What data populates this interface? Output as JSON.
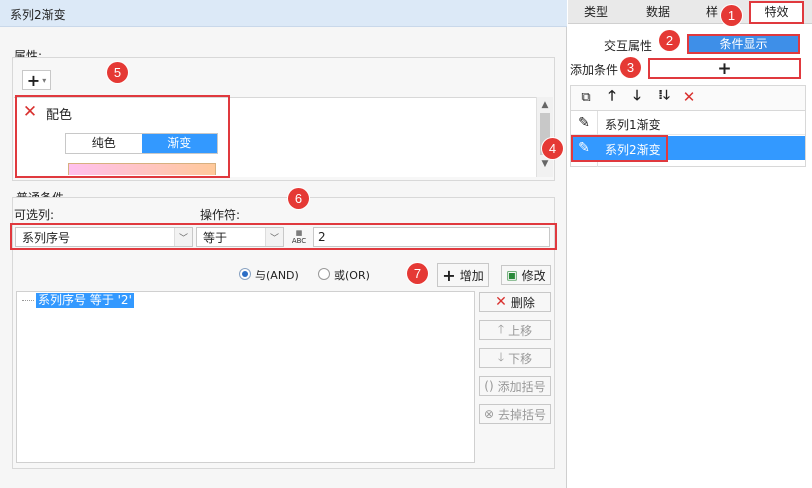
{
  "left_title": "系列2渐变",
  "properties": {
    "section_label": "属性:",
    "add_symbol": "+",
    "color_label": "配色",
    "solid_label": "纯色",
    "gradient_label": "渐变"
  },
  "conditions": {
    "section_label": "普通条件",
    "column_label": "可选列:",
    "operator_label": "操作符:",
    "column_value": "系列序号",
    "operator_value": "等于",
    "value": "2",
    "and_label": "与(AND)",
    "or_label": "或(OR)",
    "add_label": "增加",
    "modify_label": "修改",
    "list": [
      "系列序号 等于 '2'"
    ],
    "delete_label": "删除",
    "up_label": "上移",
    "down_label": "下移",
    "add_bracket_label": "添加括号",
    "remove_bracket_label": "去掉括号"
  },
  "right_panel": {
    "tabs": [
      "类型",
      "数据",
      "样",
      "特效"
    ],
    "interactive_label": "交互属性",
    "condition_display_label": "条件显示",
    "add_condition_label": "添加条件",
    "add_condition_symbol": "+",
    "items": [
      "系列1渐变",
      "系列2渐变"
    ]
  },
  "badges": [
    "1",
    "2",
    "3",
    "4",
    "5",
    "6",
    "7"
  ],
  "colors": {
    "accent": "#3e8fe8",
    "highlight": "#3399ff",
    "annotation": "#e0393e"
  }
}
